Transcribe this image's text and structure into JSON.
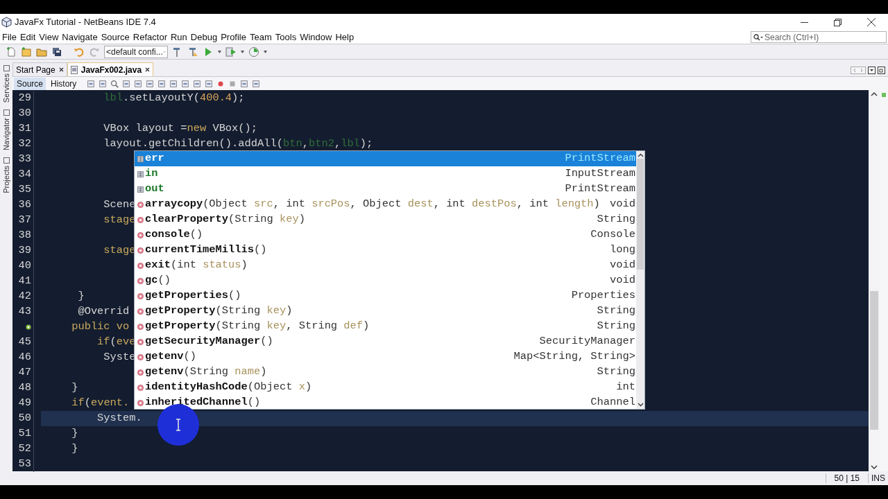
{
  "window": {
    "title": "JavaFx Tutorial - NetBeans IDE 7.4"
  },
  "menu": [
    "File",
    "Edit",
    "View",
    "Navigate",
    "Source",
    "Refactor",
    "Run",
    "Debug",
    "Profile",
    "Team",
    "Tools",
    "Window",
    "Help"
  ],
  "search": {
    "placeholder": "Search (Ctrl+I)"
  },
  "toolbar": {
    "configuration": "<default confi..."
  },
  "side_tabs": [
    "Services",
    "Navigator",
    "Projects"
  ],
  "tabs": [
    {
      "label": "Start Page",
      "selected": false
    },
    {
      "label": "JavaFx002.java",
      "selected": true
    }
  ],
  "editor_modes": [
    {
      "label": "Source",
      "selected": true
    },
    {
      "label": "History",
      "selected": false
    }
  ],
  "lines": [
    {
      "number": "29",
      "current": false,
      "annotated": false,
      "code": [
        {
          "kind": "field",
          "text": "          lbl"
        },
        {
          "kind": "plain",
          "text": ".setLayoutY("
        },
        {
          "kind": "number",
          "text": "400.4"
        },
        {
          "kind": "plain",
          "text": ");"
        }
      ]
    },
    {
      "number": "30",
      "current": false,
      "annotated": false
    },
    {
      "number": "31",
      "current": false,
      "annotated": false,
      "code": [
        {
          "kind": "plain",
          "text": "          VBox layout ="
        },
        {
          "kind": "keyword",
          "text": "new"
        },
        {
          "kind": "plain",
          "text": " VBox();"
        }
      ]
    },
    {
      "number": "32",
      "current": false,
      "annotated": false,
      "code": [
        {
          "kind": "plain",
          "text": "          layout.getChildren().addAll("
        },
        {
          "kind": "field",
          "text": "btn"
        },
        {
          "kind": "plain",
          "text": ","
        },
        {
          "kind": "field",
          "text": "btn2"
        },
        {
          "kind": "plain",
          "text": ","
        },
        {
          "kind": "field",
          "text": "lbl"
        },
        {
          "kind": "plain",
          "text": ");"
        }
      ]
    },
    {
      "number": "33",
      "current": false,
      "annotated": false
    },
    {
      "number": "34",
      "current": false,
      "annotated": false
    },
    {
      "number": "35",
      "current": false,
      "annotated": false
    },
    {
      "number": "36",
      "current": false,
      "annotated": false,
      "code": [
        {
          "kind": "plain",
          "text": "          Scene"
        }
      ]
    },
    {
      "number": "37",
      "current": false,
      "annotated": false,
      "code": [
        {
          "kind": "param",
          "text": "          stage"
        }
      ]
    },
    {
      "number": "38",
      "current": false,
      "annotated": false
    },
    {
      "number": "39",
      "current": false,
      "annotated": false,
      "code": [
        {
          "kind": "param",
          "text": "          stage"
        }
      ]
    },
    {
      "number": "40",
      "current": false,
      "annotated": false
    },
    {
      "number": "41",
      "current": false,
      "annotated": false
    },
    {
      "number": "42",
      "current": false,
      "annotated": false,
      "code": [
        {
          "kind": "plain",
          "text": "      }"
        }
      ]
    },
    {
      "number": "43",
      "current": false,
      "annotated": false,
      "code": [
        {
          "kind": "plain",
          "text": "      @Overrid"
        }
      ]
    },
    {
      "current": false,
      "annotated": true,
      "code": [
        {
          "kind": "keyword",
          "text": "     public vo"
        }
      ]
    },
    {
      "number": "45",
      "current": false,
      "annotated": false,
      "code": [
        {
          "kind": "keyword",
          "text": "         if"
        },
        {
          "kind": "plain",
          "text": "("
        },
        {
          "kind": "param",
          "text": "eve"
        }
      ]
    },
    {
      "number": "46",
      "current": false,
      "annotated": false,
      "code": [
        {
          "kind": "plain",
          "text": "          Syste"
        }
      ]
    },
    {
      "number": "47",
      "current": false,
      "annotated": false
    },
    {
      "number": "48",
      "current": false,
      "annotated": false,
      "code": [
        {
          "kind": "plain",
          "text": "     }"
        }
      ]
    },
    {
      "number": "49",
      "current": false,
      "annotated": false,
      "code": [
        {
          "kind": "keyword",
          "text": "     if"
        },
        {
          "kind": "plain",
          "text": "("
        },
        {
          "kind": "param",
          "text": "event."
        }
      ]
    },
    {
      "number": "50",
      "current": true,
      "annotated": false,
      "code": [
        {
          "kind": "plain",
          "text": "         System."
        }
      ]
    },
    {
      "number": "51",
      "current": false,
      "annotated": false,
      "code": [
        {
          "kind": "plain",
          "text": "     }"
        }
      ]
    },
    {
      "number": "52",
      "current": false,
      "annotated": false,
      "code": [
        {
          "kind": "plain",
          "text": "     }"
        }
      ]
    },
    {
      "number": "53",
      "current": false,
      "annotated": false
    }
  ],
  "completion": [
    {
      "kind": "field",
      "name": "err",
      "returns": "PrintStream",
      "selected": true
    },
    {
      "kind": "field",
      "name": "in",
      "returns": "InputStream",
      "selected": false
    },
    {
      "kind": "field",
      "name": "out",
      "returns": "PrintStream",
      "selected": false
    },
    {
      "kind": "method",
      "name": "arraycopy",
      "args": [
        {
          "kind": "plain",
          "text": "(Object "
        },
        {
          "kind": "param",
          "text": "src"
        },
        {
          "kind": "plain",
          "text": ", int "
        },
        {
          "kind": "param",
          "text": "srcPos"
        },
        {
          "kind": "plain",
          "text": ", Object "
        },
        {
          "kind": "param",
          "text": "dest"
        },
        {
          "kind": "plain",
          "text": ", int "
        },
        {
          "kind": "param",
          "text": "destPos"
        },
        {
          "kind": "plain",
          "text": ", int "
        },
        {
          "kind": "param",
          "text": "length"
        },
        {
          "kind": "plain",
          "text": ")"
        }
      ],
      "returns": "void",
      "selected": false
    },
    {
      "kind": "method",
      "name": "clearProperty",
      "args": [
        {
          "kind": "plain",
          "text": "(String "
        },
        {
          "kind": "param",
          "text": "key"
        },
        {
          "kind": "plain",
          "text": ")"
        }
      ],
      "returns": "String",
      "selected": false
    },
    {
      "kind": "method",
      "name": "console",
      "args": [
        {
          "kind": "plain",
          "text": "()"
        }
      ],
      "returns": "Console",
      "selected": false
    },
    {
      "kind": "method",
      "name": "currentTimeMillis",
      "args": [
        {
          "kind": "plain",
          "text": "()"
        }
      ],
      "returns": "long",
      "selected": false
    },
    {
      "kind": "method",
      "name": "exit",
      "args": [
        {
          "kind": "plain",
          "text": "(int "
        },
        {
          "kind": "param",
          "text": "status"
        },
        {
          "kind": "plain",
          "text": ")"
        }
      ],
      "returns": "void",
      "selected": false
    },
    {
      "kind": "method",
      "name": "gc",
      "args": [
        {
          "kind": "plain",
          "text": "()"
        }
      ],
      "returns": "void",
      "selected": false
    },
    {
      "kind": "method",
      "name": "getProperties",
      "args": [
        {
          "kind": "plain",
          "text": "()"
        }
      ],
      "returns": "Properties",
      "selected": false
    },
    {
      "kind": "method",
      "name": "getProperty",
      "args": [
        {
          "kind": "plain",
          "text": "(String "
        },
        {
          "kind": "param",
          "text": "key"
        },
        {
          "kind": "plain",
          "text": ")"
        }
      ],
      "returns": "String",
      "selected": false
    },
    {
      "kind": "method",
      "name": "getProperty",
      "args": [
        {
          "kind": "plain",
          "text": "(String "
        },
        {
          "kind": "param",
          "text": "key"
        },
        {
          "kind": "plain",
          "text": ", String "
        },
        {
          "kind": "param",
          "text": "def"
        },
        {
          "kind": "plain",
          "text": ")"
        }
      ],
      "returns": "String",
      "selected": false
    },
    {
      "kind": "method",
      "name": "getSecurityManager",
      "args": [
        {
          "kind": "plain",
          "text": "()"
        }
      ],
      "returns": "SecurityManager",
      "selected": false
    },
    {
      "kind": "method",
      "name": "getenv",
      "args": [
        {
          "kind": "plain",
          "text": "()"
        }
      ],
      "returns": "Map<String, String>",
      "selected": false
    },
    {
      "kind": "method",
      "name": "getenv",
      "args": [
        {
          "kind": "plain",
          "text": "(String "
        },
        {
          "kind": "param",
          "text": "name"
        },
        {
          "kind": "plain",
          "text": ")"
        }
      ],
      "returns": "String",
      "selected": false
    },
    {
      "kind": "method",
      "name": "identityHashCode",
      "args": [
        {
          "kind": "plain",
          "text": "(Object "
        },
        {
          "kind": "param",
          "text": "x"
        },
        {
          "kind": "plain",
          "text": ")"
        }
      ],
      "returns": "int",
      "selected": false
    },
    {
      "kind": "method",
      "name": "inheritedChannel",
      "args": [
        {
          "kind": "plain",
          "text": "()"
        }
      ],
      "returns": "Channel",
      "selected": false
    }
  ],
  "status_bar": {
    "position": "50 | 15",
    "mode": "INS"
  }
}
